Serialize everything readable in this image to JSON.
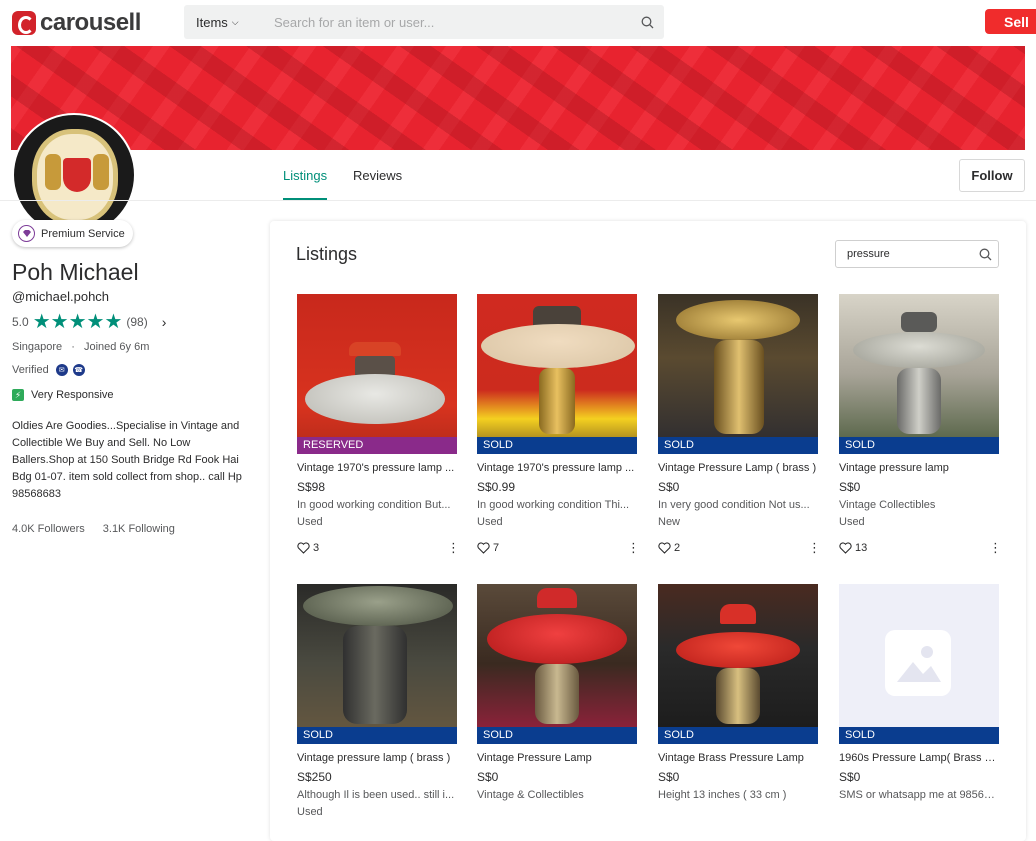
{
  "header": {
    "logo_text": "carousell",
    "category_label": "Items",
    "search_placeholder": "Search for an item or user...",
    "sell_label": "Sell"
  },
  "profile": {
    "premium_label": "Premium Service",
    "name": "Poh Michael",
    "handle": "@michael.pohch",
    "rating": "5.0",
    "review_count": "(98)",
    "location": "Singapore",
    "separator": "·",
    "joined": "Joined 6y 6m",
    "verified_label": "Verified",
    "responsive_label": "Very Responsive",
    "bio": "Oldies Are Goodies...Specialise in Vintage and Collectible We Buy and Sell. No Low Ballers.Shop at 150 South Bridge Rd Fook Hai Bdg 01-07. item sold collect from shop.. call Hp 98568683",
    "followers": "4.0K Followers",
    "following": "3.1K Following"
  },
  "tabs": [
    {
      "label": "Listings"
    },
    {
      "label": "Reviews"
    }
  ],
  "follow_label": "Follow",
  "listings": {
    "title": "Listings",
    "search_value": "pressure",
    "items": [
      {
        "badge": "RESERVED",
        "title": "Vintage 1970's pressure lamp ...",
        "price": "S$98",
        "desc": "In good working condition But...",
        "cond": "Used",
        "likes": "3"
      },
      {
        "badge": "SOLD",
        "title": "Vintage 1970's pressure lamp ...",
        "price": "S$0.99",
        "desc": "In good working condition Thi...",
        "cond": "Used",
        "likes": "7"
      },
      {
        "badge": "SOLD",
        "title": "Vintage Pressure Lamp ( brass )",
        "price": "S$0",
        "desc": "In very good condition Not us...",
        "cond": "New",
        "likes": "2"
      },
      {
        "badge": "SOLD",
        "title": "Vintage pressure lamp",
        "price": "S$0",
        "desc": "Vintage Collectibles",
        "cond": "Used",
        "likes": "13"
      },
      {
        "badge": "SOLD",
        "title": "Vintage pressure lamp ( brass )",
        "price": "S$250",
        "desc": "Although Il is been used.. still i...",
        "cond": "Used",
        "likes": ""
      },
      {
        "badge": "SOLD",
        "title": "Vintage Pressure Lamp",
        "price": "S$0",
        "desc": "Vintage & Collectibles",
        "cond": "",
        "likes": ""
      },
      {
        "badge": "SOLD",
        "title": "Vintage Brass Pressure Lamp",
        "price": "S$0",
        "desc": "Height 13 inches ( 33 cm )",
        "cond": "",
        "likes": ""
      },
      {
        "badge": "SOLD",
        "title": "1960s Pressure Lamp( Brass )....",
        "price": "S$0",
        "desc": "SMS or whatsapp me at 98568...",
        "cond": "",
        "likes": ""
      }
    ]
  },
  "colors": {
    "brand_red": "#d2232a",
    "accent_green": "#008f79",
    "sold_blue": "#0a3d8f",
    "reserved_purple": "#8a2a8a"
  }
}
